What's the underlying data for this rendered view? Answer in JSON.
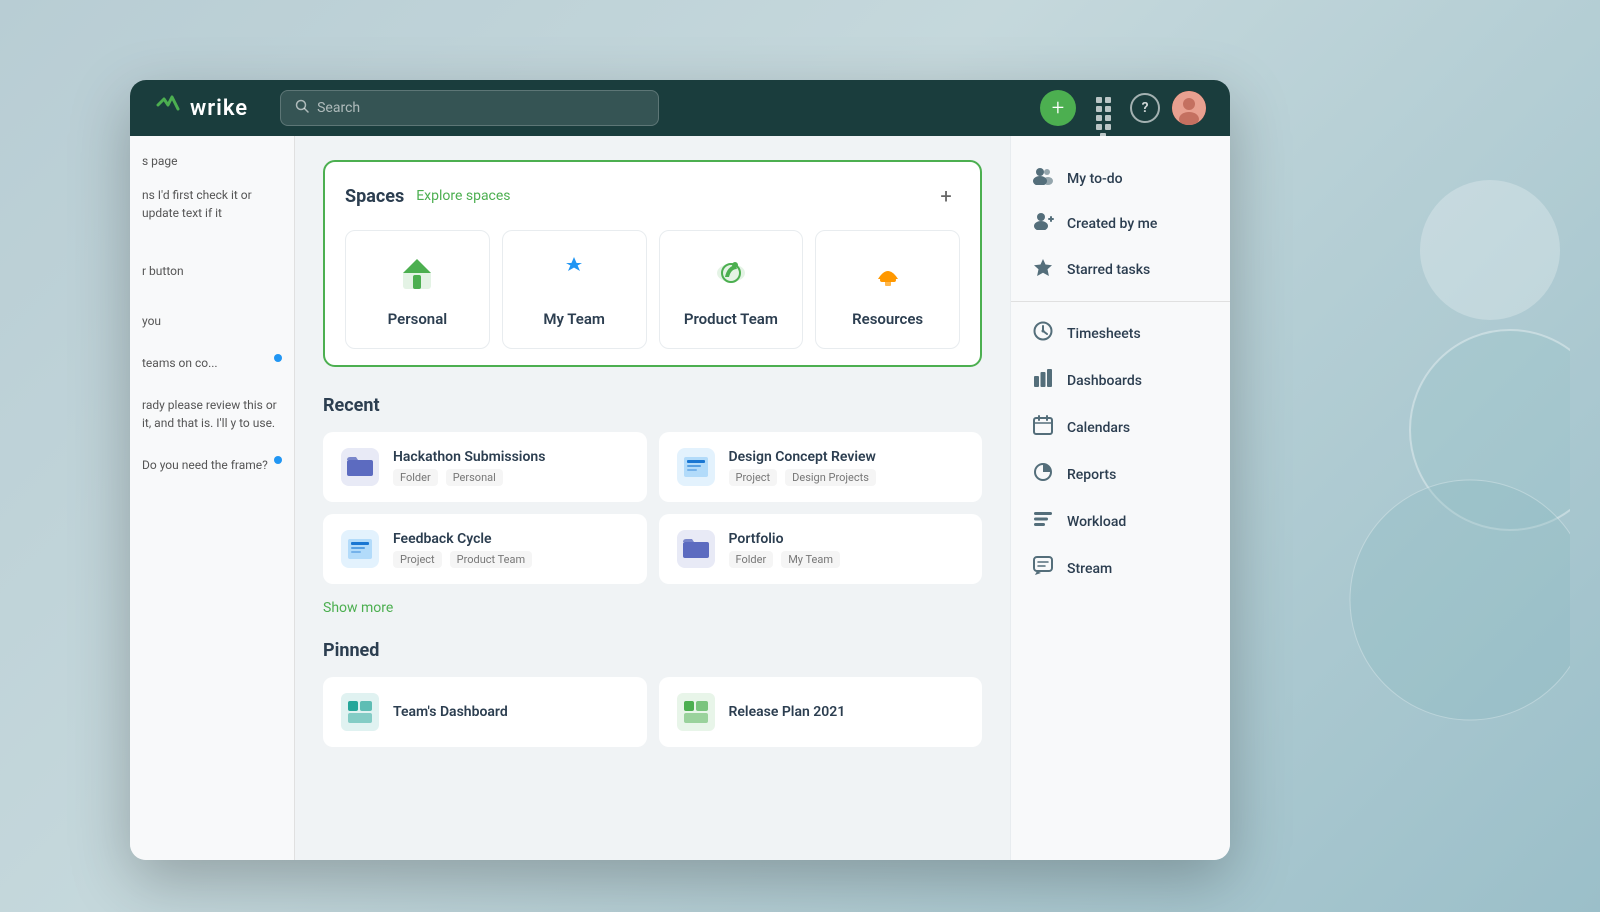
{
  "colors": {
    "topbar": "#1a3d3d",
    "accent_green": "#4caf50",
    "border_green": "#4caf50"
  },
  "topbar": {
    "logo_text": "wrike",
    "search_placeholder": "Search",
    "add_button_label": "+",
    "help_label": "?"
  },
  "spaces": {
    "title": "Spaces",
    "explore_link": "Explore spaces",
    "add_label": "+",
    "items": [
      {
        "id": "personal",
        "label": "Personal",
        "icon": "🏠",
        "color": "#4caf50"
      },
      {
        "id": "my-team",
        "label": "My Team",
        "icon": "⚡",
        "color": "#2196f3"
      },
      {
        "id": "product-team",
        "label": "Product Team",
        "icon": "🚀",
        "color": "#4caf50"
      },
      {
        "id": "resources",
        "label": "Resources",
        "icon": "🎓",
        "color": "#ff9800"
      }
    ]
  },
  "recent": {
    "title": "Recent",
    "items": [
      {
        "name": "Hackathon Submissions",
        "type": "Folder",
        "space": "Personal",
        "icon_type": "folder"
      },
      {
        "name": "Design Concept Review",
        "type": "Project",
        "space": "Design Projects",
        "icon_type": "project"
      },
      {
        "name": "Feedback Cycle",
        "type": "Project",
        "space": "Product Team",
        "icon_type": "project"
      },
      {
        "name": "Portfolio",
        "type": "Folder",
        "space": "My Team",
        "icon_type": "folder"
      }
    ],
    "show_more_label": "Show more"
  },
  "pinned": {
    "title": "Pinned",
    "items": [
      {
        "name": "Team's Dashboard",
        "icon_type": "teal"
      },
      {
        "name": "Release Plan 2021",
        "icon_type": "green"
      }
    ]
  },
  "sidebar": {
    "items": [
      {
        "id": "my-todo",
        "label": "My to-do",
        "icon": "people"
      },
      {
        "id": "created-by-me",
        "label": "Created by me",
        "icon": "person-add"
      },
      {
        "id": "starred-tasks",
        "label": "Starred tasks",
        "icon": "star"
      },
      {
        "id": "timesheets",
        "label": "Timesheets",
        "icon": "clock"
      },
      {
        "id": "dashboards",
        "label": "Dashboards",
        "icon": "bar-chart"
      },
      {
        "id": "calendars",
        "label": "Calendars",
        "icon": "calendar"
      },
      {
        "id": "reports",
        "label": "Reports",
        "icon": "pie-chart"
      },
      {
        "id": "workload",
        "label": "Workload",
        "icon": "workload"
      },
      {
        "id": "stream",
        "label": "Stream",
        "icon": "chat"
      }
    ]
  },
  "chat_panel": {
    "items": [
      {
        "text": "s page",
        "has_dot": false
      },
      {
        "text": "ns I'd first check it or update text if it",
        "has_dot": false
      },
      {
        "text": "r button",
        "has_dot": false
      },
      {
        "text": "you",
        "has_dot": false
      },
      {
        "text": "teams on co...",
        "has_dot": true
      },
      {
        "text": "rady please review this or it, and that is. I'll y to use.",
        "has_dot": false
      },
      {
        "text": "Do you need the frame?",
        "has_dot": false
      }
    ]
  }
}
